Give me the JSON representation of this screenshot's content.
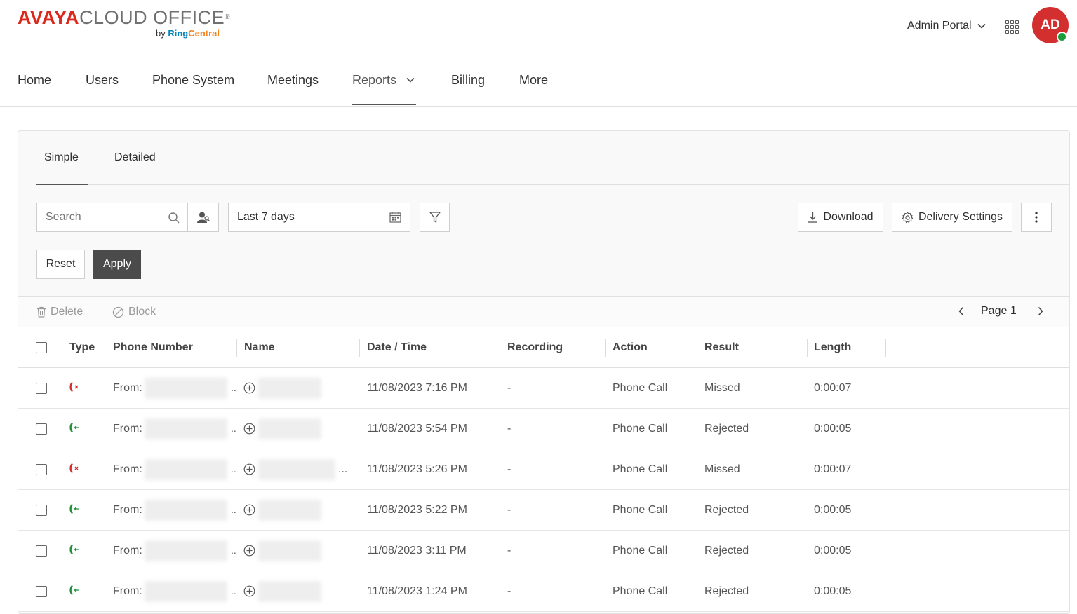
{
  "brand": {
    "main": "AVAYA",
    "rest": "CLOUD OFFICE",
    "reg": "®",
    "sub_prefix": "by ",
    "sub_ring": "Ring",
    "sub_central": "Central"
  },
  "header": {
    "portal_label": "Admin Portal",
    "avatar_initials": "AD",
    "presence_color": "#1a9c3a",
    "avatar_color": "#d32f2f"
  },
  "nav": {
    "items": [
      "Home",
      "Users",
      "Phone System",
      "Meetings",
      "Reports",
      "Billing",
      "More"
    ],
    "active": "Reports"
  },
  "subtabs": {
    "simple": "Simple",
    "detailed": "Detailed"
  },
  "filters": {
    "search_placeholder": "Search",
    "date_range": "Last 7 days",
    "reset": "Reset",
    "apply": "Apply",
    "download": "Download",
    "delivery_settings": "Delivery Settings"
  },
  "actions": {
    "delete": "Delete",
    "block": "Block",
    "page": "Page 1"
  },
  "table": {
    "columns": [
      "Type",
      "Phone Number",
      "Name",
      "Date / Time",
      "Recording",
      "Action",
      "Result",
      "Length"
    ],
    "rows": [
      {
        "type": "missed",
        "from": "From:",
        "datetime": "11/08/2023 7:16 PM",
        "recording": "-",
        "action": "Phone Call",
        "result": "Missed",
        "length": "0:00:07",
        "name_ellipsis": ""
      },
      {
        "type": "incoming",
        "from": "From:",
        "datetime": "11/08/2023 5:54 PM",
        "recording": "-",
        "action": "Phone Call",
        "result": "Rejected",
        "length": "0:00:05",
        "name_ellipsis": ""
      },
      {
        "type": "missed",
        "from": "From:",
        "datetime": "11/08/2023 5:26 PM",
        "recording": "-",
        "action": "Phone Call",
        "result": "Missed",
        "length": "0:00:07",
        "name_ellipsis": "..."
      },
      {
        "type": "incoming",
        "from": "From:",
        "datetime": "11/08/2023 5:22 PM",
        "recording": "-",
        "action": "Phone Call",
        "result": "Rejected",
        "length": "0:00:05",
        "name_ellipsis": ""
      },
      {
        "type": "incoming",
        "from": "From:",
        "datetime": "11/08/2023 3:11 PM",
        "recording": "-",
        "action": "Phone Call",
        "result": "Rejected",
        "length": "0:00:05",
        "name_ellipsis": ""
      },
      {
        "type": "incoming",
        "from": "From:",
        "datetime": "11/08/2023 1:24 PM",
        "recording": "-",
        "action": "Phone Call",
        "result": "Rejected",
        "length": "0:00:05",
        "name_ellipsis": ""
      }
    ],
    "row_dots": ".."
  },
  "colors": {
    "missed": "#d32f2f",
    "incoming": "#1f8f3a",
    "apply_bg": "#4b4b4b"
  }
}
